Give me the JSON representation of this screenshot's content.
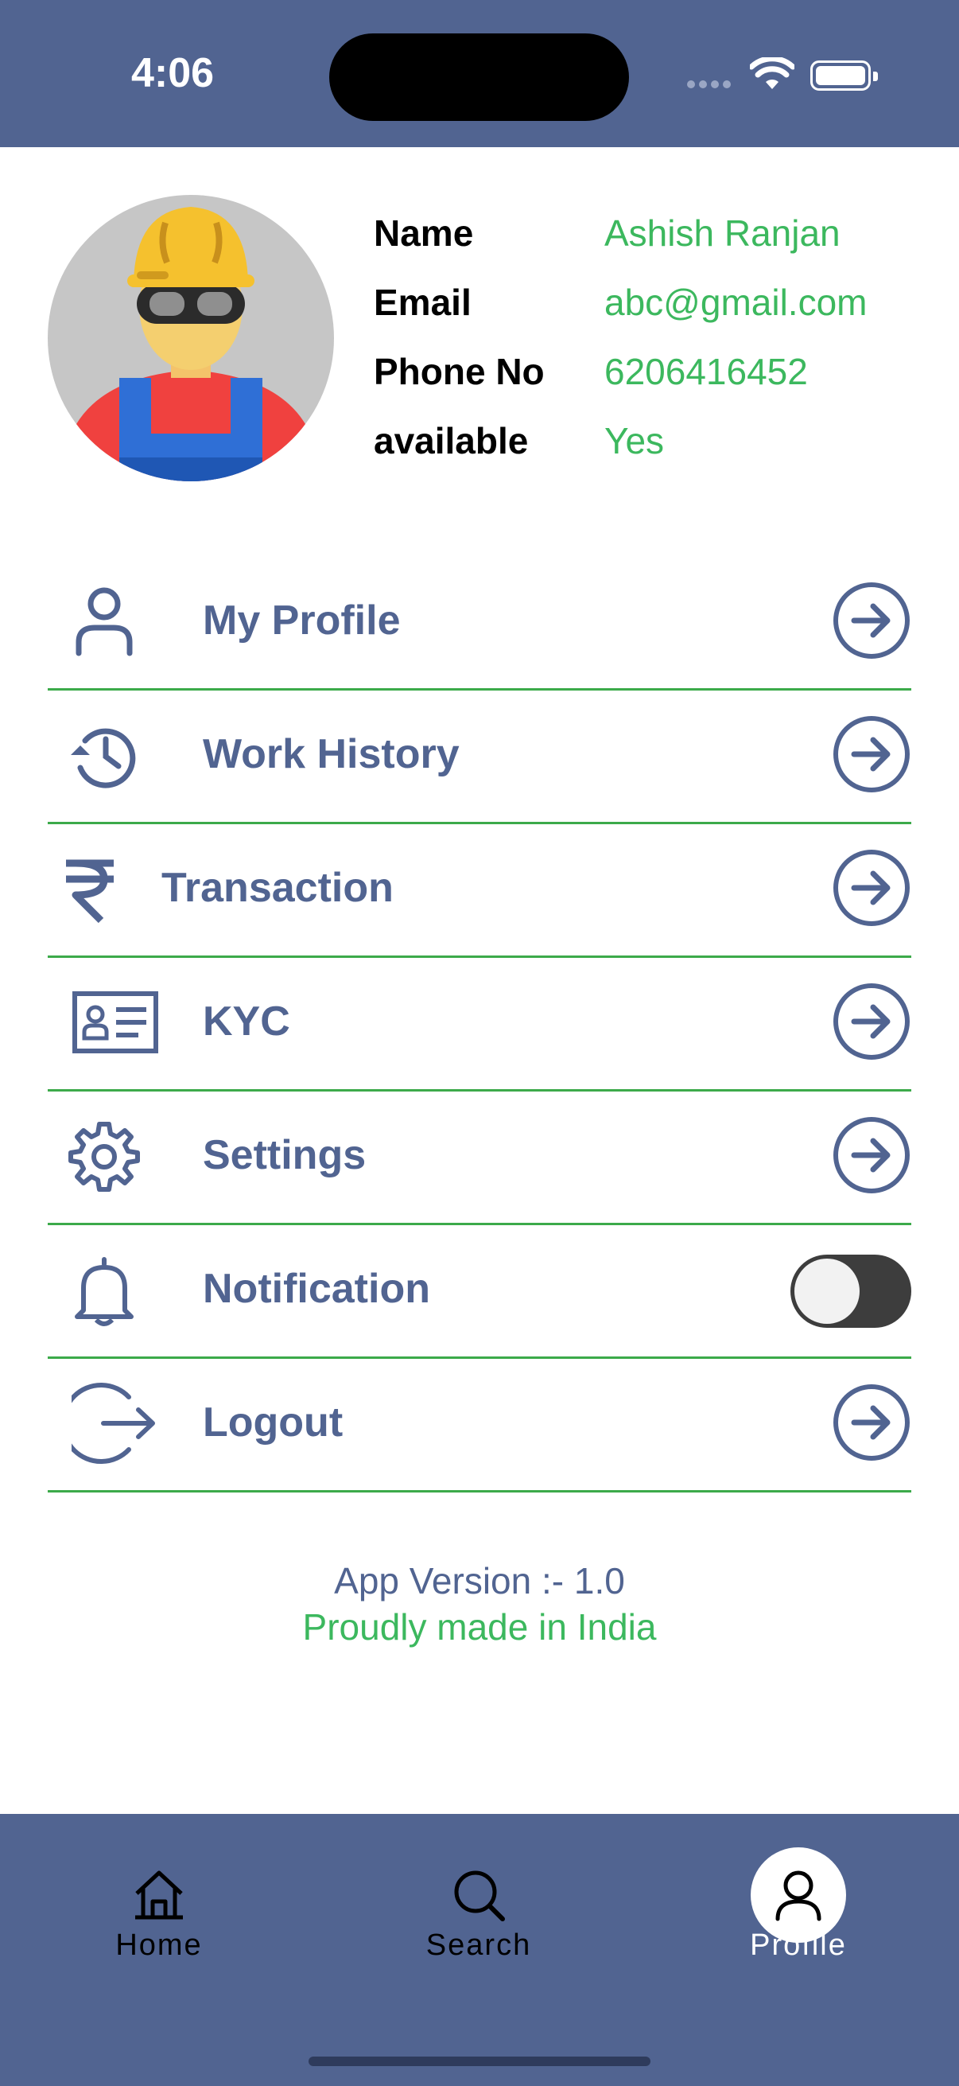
{
  "status": {
    "time": "4:06"
  },
  "profile": {
    "fields": [
      {
        "label": "Name",
        "value": "Ashish Ranjan"
      },
      {
        "label": "Email",
        "value": "abc@gmail.com"
      },
      {
        "label": "Phone No",
        "value": "6206416452"
      },
      {
        "label": "available",
        "value": "Yes"
      }
    ]
  },
  "menu": {
    "items": [
      {
        "label": "My Profile",
        "icon": "user-icon"
      },
      {
        "label": "Work History",
        "icon": "history-icon"
      },
      {
        "label": "Transaction",
        "icon": "rupee-icon"
      },
      {
        "label": "KYC",
        "icon": "id-card-icon"
      },
      {
        "label": "Settings",
        "icon": "gear-icon"
      },
      {
        "label": "Notification",
        "icon": "bell-icon",
        "toggle": false
      },
      {
        "label": "Logout",
        "icon": "logout-icon"
      }
    ]
  },
  "footer": {
    "version": "App Version :- 1.0",
    "tagline": "Proudly made in India"
  },
  "tabs": [
    {
      "label": "Home",
      "icon": "home-icon"
    },
    {
      "label": "Search",
      "icon": "search-icon"
    },
    {
      "label": "Profile",
      "icon": "user-icon",
      "active": true
    }
  ],
  "colors": {
    "primary": "#516491",
    "accent": "#3cb85e",
    "divider": "#3caa4a"
  }
}
